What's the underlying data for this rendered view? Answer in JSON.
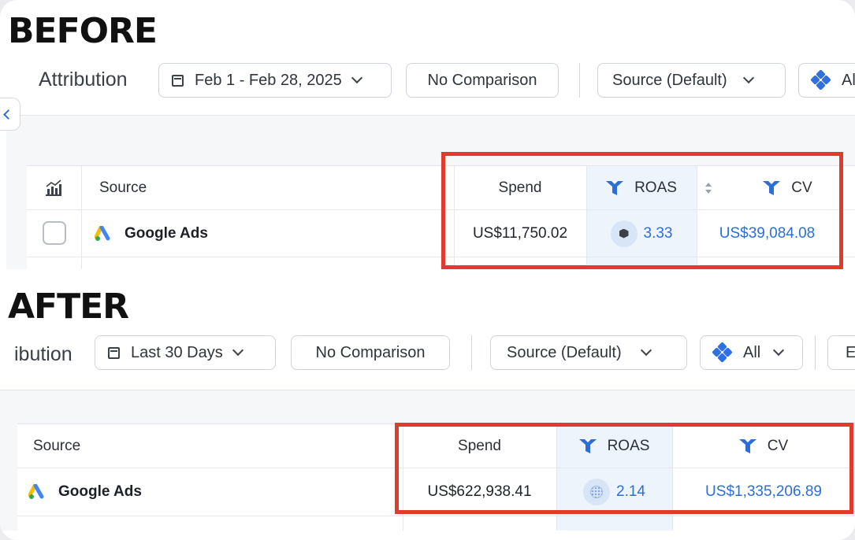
{
  "headings": {
    "before": "BEFORE",
    "after": "AFTER"
  },
  "before": {
    "toolbar": {
      "title": "Attribution",
      "date_range": "Feb 1 - Feb 28, 2025",
      "comparison": "No Comparison",
      "source": "Source (Default)",
      "all_filter": "Al"
    },
    "table": {
      "columns": {
        "source": "Source",
        "spend": "Spend",
        "roas": "ROAS",
        "cv": "CV"
      },
      "rows": [
        {
          "source": "Google Ads",
          "spend": "US$11,750.02",
          "roas": "3.33",
          "cv": "US$39,084.08"
        }
      ]
    }
  },
  "after": {
    "toolbar": {
      "title": "ibution",
      "date_range": "Last 30 Days",
      "comparison": "No Comparison",
      "source": "Source (Default)",
      "all_filter": "All",
      "extra": "E"
    },
    "table": {
      "columns": {
        "source": "Source",
        "spend": "Spend",
        "roas": "ROAS",
        "cv": "CV"
      },
      "rows": [
        {
          "source": "Google Ads",
          "spend": "US$622,938.41",
          "roas": "2.14",
          "cv": "US$1,335,206.89"
        }
      ]
    }
  },
  "colors": {
    "highlight": "#e33a2e",
    "accent": "#2b6fd6",
    "roas_column": "#eef4fc"
  },
  "icons": [
    "calendar-icon",
    "chevron-down-icon",
    "filter-diamonds-icon",
    "funnel-icon",
    "google-ads-icon",
    "chart-icon",
    "sort-icon",
    "collapse-chevron-icon"
  ]
}
